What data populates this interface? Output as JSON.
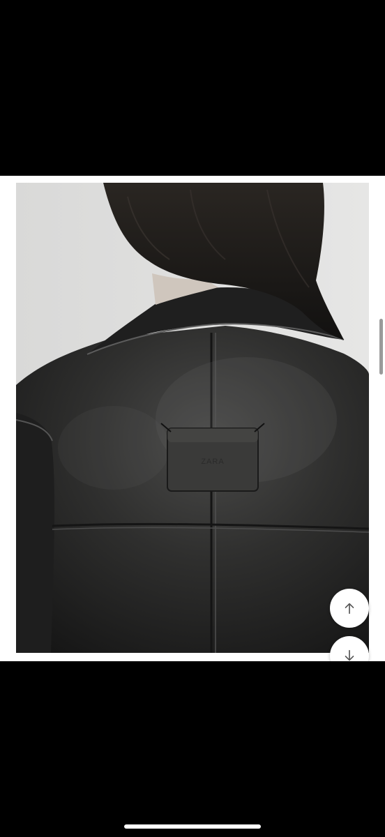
{
  "product_image": {
    "alt": "",
    "patch_label": "ZARA"
  },
  "controls": {
    "scroll_up_icon": "arrow-up-icon",
    "scroll_down_icon": "arrow-down-icon"
  },
  "colors": {
    "background": "#000000",
    "card": "#ffffff",
    "leather": "#2b2b2b"
  }
}
